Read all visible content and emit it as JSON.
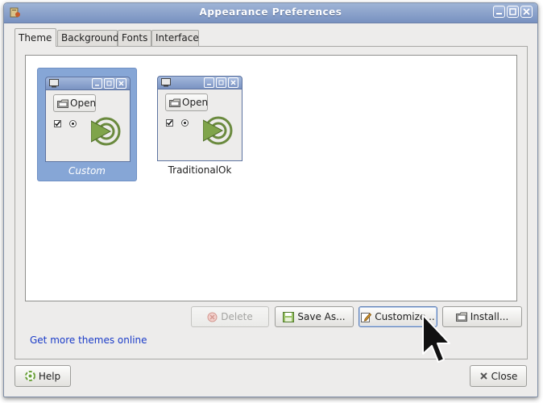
{
  "window": {
    "title": "Appearance Preferences"
  },
  "tabs": [
    {
      "label": "Theme",
      "active": true
    },
    {
      "label": "Background",
      "active": false
    },
    {
      "label": "Fonts",
      "active": false
    },
    {
      "label": "Interface",
      "active": false
    }
  ],
  "themes": [
    {
      "name": "Custom",
      "selected": true,
      "open_label": "Open"
    },
    {
      "name": "TraditionalOk",
      "selected": false,
      "open_label": "Open"
    }
  ],
  "actions": {
    "delete_label": "Delete",
    "save_as_label": "Save As...",
    "customize_label": "Customize...",
    "install_label": "Install..."
  },
  "link_text": "Get more themes online",
  "footer": {
    "help_label": "Help",
    "close_label": "Close"
  },
  "colors": {
    "accent": "#86a6d6",
    "titlebar": "#7891c0",
    "link": "#1a3bc8"
  }
}
